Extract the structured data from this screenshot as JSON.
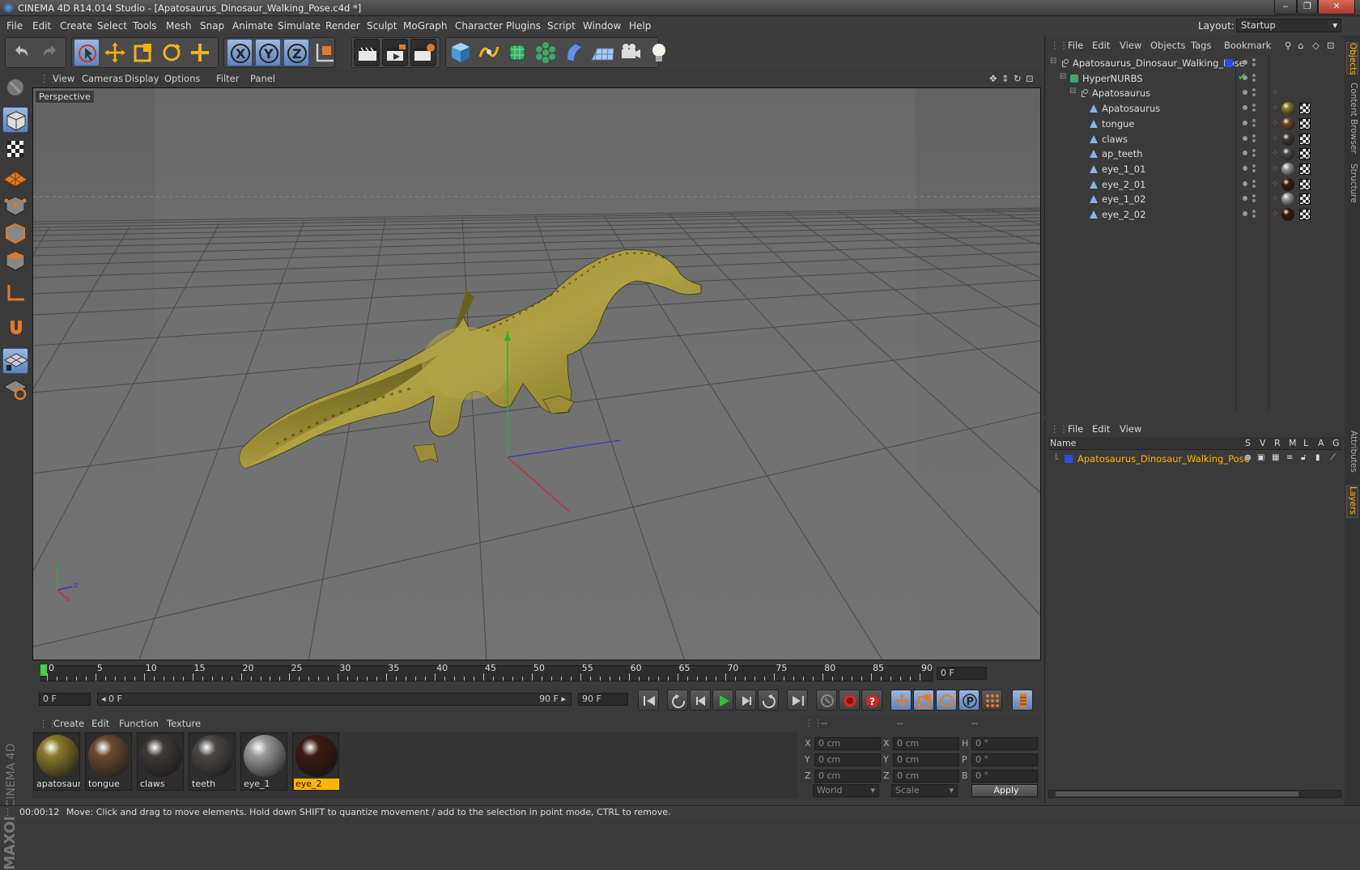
{
  "window": {
    "title": "CINEMA 4D R14.014 Studio - [Apatosaurus_Dinosaur_Walking_Pose.c4d *]",
    "minimize": "‒",
    "maximize": "❐",
    "close": "✕"
  },
  "menubar": {
    "items": [
      "File",
      "Edit",
      "Create",
      "Select",
      "Tools",
      "Mesh",
      "Snap",
      "Animate",
      "Simulate",
      "Render",
      "Sculpt",
      "MoGraph",
      "Character",
      "Plugins",
      "Script",
      "Window",
      "Help"
    ],
    "layout_label": "Layout:",
    "layout_value": "Startup"
  },
  "toolbar": {
    "icons": [
      "undo-icon",
      "redo-icon",
      "live-selection-icon",
      "move-icon",
      "scale-icon",
      "rotate-icon",
      "last-tool-icon",
      "x-axis-icon",
      "y-axis-icon",
      "z-axis-icon",
      "coordinate-system-icon",
      "render-view-icon",
      "render-picture-viewer-icon",
      "render-settings-icon",
      "cube-primitive-icon",
      "spline-icon",
      "nurbs-icon",
      "array-icon",
      "deformer-icon",
      "floor-icon",
      "camera-icon",
      "light-icon"
    ]
  },
  "viewport": {
    "menu": [
      "View",
      "Cameras",
      "Display",
      "Options",
      "Filter",
      "Panel"
    ],
    "label": "Perspective",
    "axis_x": "x",
    "axis_y": "y",
    "axis_z": "z"
  },
  "timeline": {
    "ticks": [
      "0",
      "5",
      "10",
      "15",
      "20",
      "25",
      "30",
      "35",
      "40",
      "45",
      "50",
      "55",
      "60",
      "65",
      "70",
      "75",
      "80",
      "85",
      "90"
    ],
    "current_frame_field": "0 F"
  },
  "transport": {
    "start_field": "0 F",
    "range_start": "0 F",
    "range_end": "90 F",
    "end_field": "90 F"
  },
  "materials": {
    "menu": [
      "Create",
      "Edit",
      "Function",
      "Texture"
    ],
    "items": [
      {
        "label": "apatosaurus",
        "color": "#8a7a2a"
      },
      {
        "label": "tongue",
        "color": "#6b4a2e"
      },
      {
        "label": "claws",
        "color": "#3d3a36"
      },
      {
        "label": "teeth",
        "color": "#4a4846"
      },
      {
        "label": "eye_1",
        "color": "#9a9a9a"
      },
      {
        "label": "eye_2",
        "color": "#3b1a12"
      }
    ],
    "selected_index": 5
  },
  "coordinates": {
    "header": [
      "--",
      "--",
      "--"
    ],
    "rows": [
      {
        "a": "X",
        "av": "0 cm",
        "b": "X",
        "bv": "0 cm",
        "c": "H",
        "cv": "0 °"
      },
      {
        "a": "Y",
        "av": "0 cm",
        "b": "Y",
        "bv": "0 cm",
        "c": "P",
        "cv": "0 °"
      },
      {
        "a": "Z",
        "av": "0 cm",
        "b": "Z",
        "bv": "0 cm",
        "c": "B",
        "cv": "0 °"
      }
    ],
    "mode1": "World",
    "mode2": "Scale",
    "apply": "Apply"
  },
  "status": {
    "time": "00:00:12",
    "message": "Move: Click and drag to move elements. Hold down SHIFT to quantize movement / add to the selection in point mode, CTRL to remove."
  },
  "object_manager": {
    "menu": [
      "File",
      "Edit",
      "View",
      "Objects",
      "Tags",
      "Bookmark"
    ],
    "objects": [
      {
        "name": "Apatosaurus_Dinosaur_Walking_Pose",
        "depth": 0,
        "type": "null",
        "tag": "layer"
      },
      {
        "name": "HyperNURBS",
        "depth": 1,
        "type": "hypernurbs",
        "tag": "check"
      },
      {
        "name": "Apatosaurus",
        "depth": 2,
        "type": "null",
        "tag": "none"
      },
      {
        "name": "Apatosaurus",
        "depth": 3,
        "type": "polygon",
        "tag": "apatosaurus"
      },
      {
        "name": "tongue",
        "depth": 3,
        "type": "polygon",
        "tag": "tongue"
      },
      {
        "name": "claws",
        "depth": 3,
        "type": "polygon",
        "tag": "claws"
      },
      {
        "name": "ap_teeth",
        "depth": 3,
        "type": "polygon",
        "tag": "teeth"
      },
      {
        "name": "eye_1_01",
        "depth": 3,
        "type": "polygon",
        "tag": "eye_1"
      },
      {
        "name": "eye_2_01",
        "depth": 3,
        "type": "polygon",
        "tag": "eye_2"
      },
      {
        "name": "eye_1_02",
        "depth": 3,
        "type": "polygon",
        "tag": "eye_1"
      },
      {
        "name": "eye_2_02",
        "depth": 3,
        "type": "polygon",
        "tag": "eye_2"
      }
    ]
  },
  "layer_manager": {
    "menu": [
      "File",
      "Edit",
      "View"
    ],
    "columns": [
      "Name",
      "S",
      "V",
      "R",
      "M",
      "L",
      "A",
      "G"
    ],
    "layers": [
      {
        "name": "Apatosaurus_Dinosaur_Walking_Pose",
        "color": "#2a4de0"
      }
    ]
  },
  "right_tabs": [
    "Objects",
    "Content Browser",
    "Structure",
    "Attributes",
    "Layers"
  ]
}
